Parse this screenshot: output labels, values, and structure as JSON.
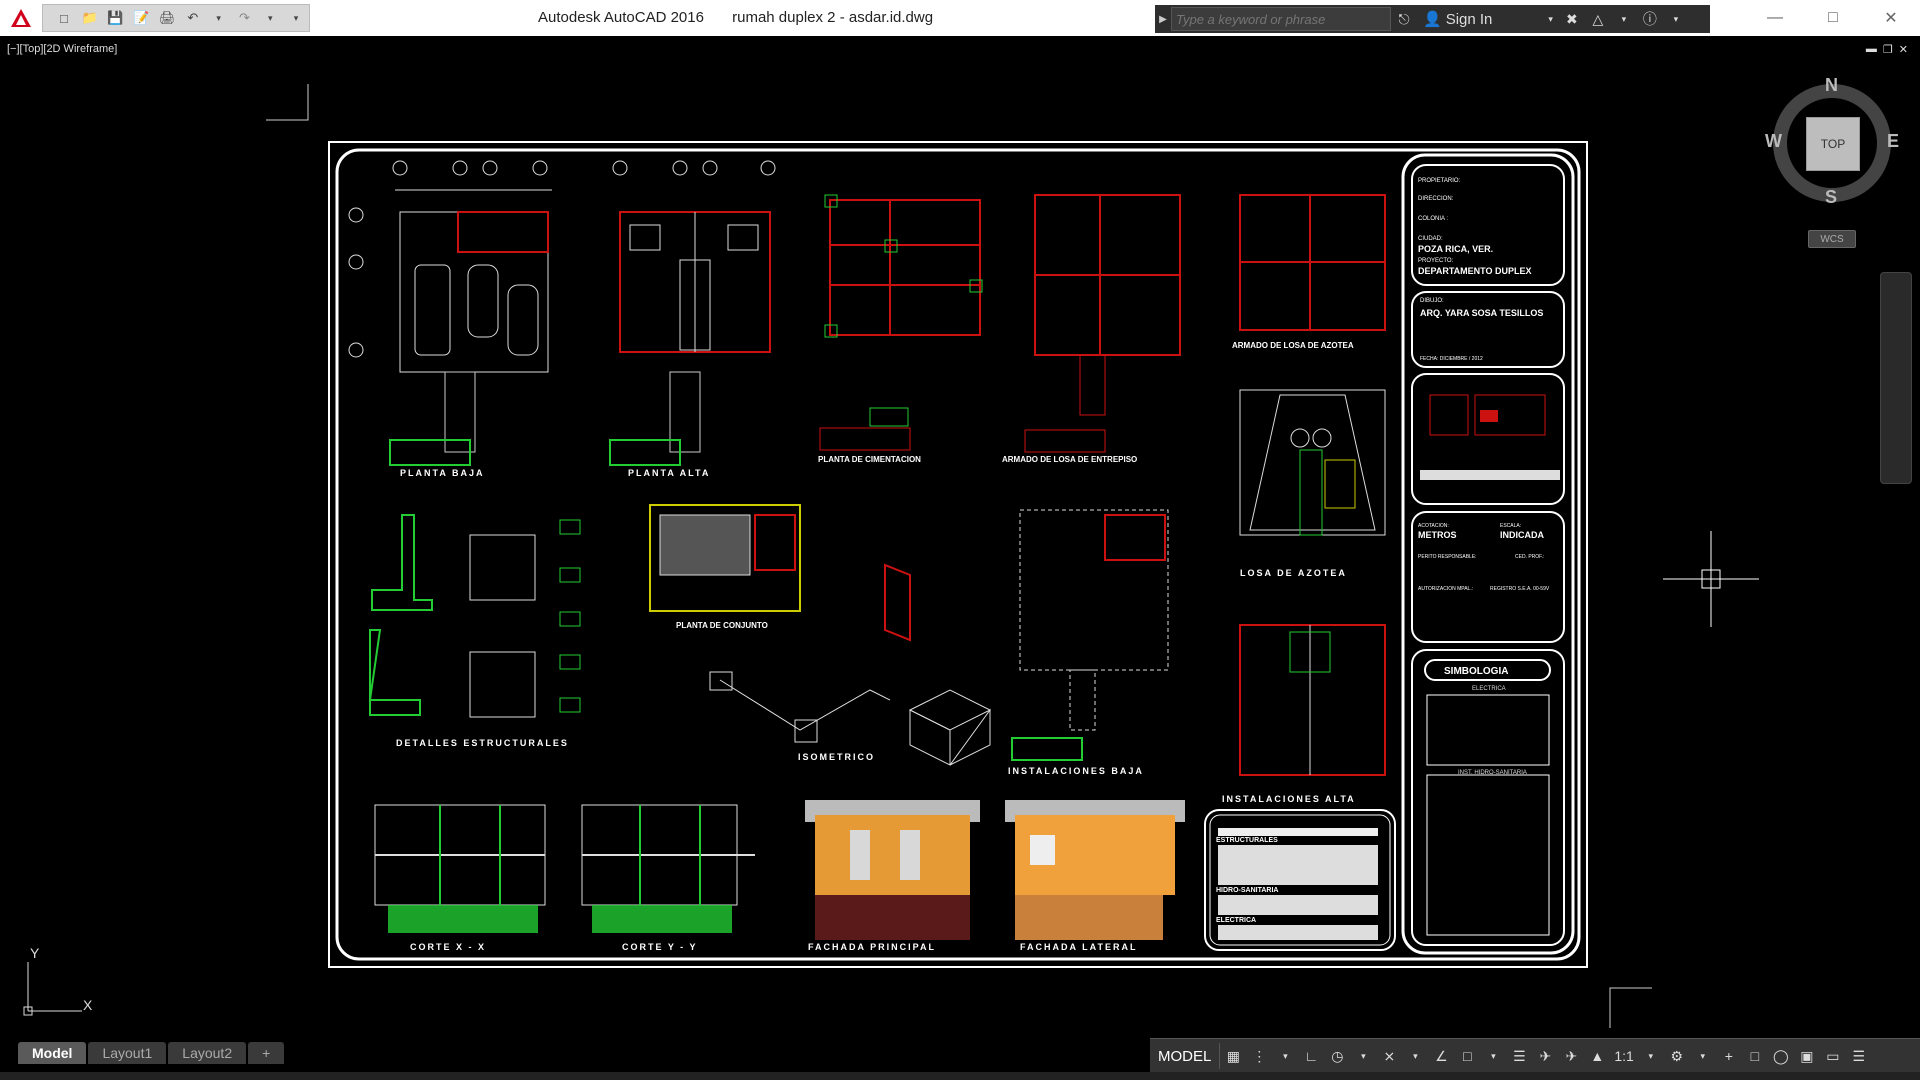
{
  "title_bar": {
    "app_name": "Autodesk AutoCAD 2016",
    "file_name": "rumah duplex 2 - asdar.id.dwg",
    "search_placeholder": "Type a keyword or phrase",
    "sign_in_label": "Sign In"
  },
  "viewport": {
    "label": "[−][Top][2D Wireframe]"
  },
  "viewcube": {
    "north": "N",
    "south": "S",
    "east": "E",
    "west": "W",
    "face": "TOP",
    "wcs": "WCS"
  },
  "sheet": {
    "labels": {
      "planta_baja": "PLANTA BAJA",
      "planta_alta": "PLANTA ALTA",
      "cimentacion": "PLANTA DE CIMENTACION",
      "armado_entrepiso": "ARMADO DE LOSA DE ENTREPISO",
      "armado_azotea": "ARMADO DE LOSA DE AZOTEA",
      "losa_azotea": "LOSA DE AZOTEA",
      "detalles": "DETALLES ESTRUCTURALES",
      "conjunto": "PLANTA DE CONJUNTO",
      "isometrico": "ISOMETRICO",
      "inst_baja": "INSTALACIONES BAJA",
      "inst_alta": "INSTALACIONES ALTA",
      "corte_x": "CORTE X - X",
      "corte_y": "CORTE Y - Y",
      "fachada_principal": "FACHADA PRINCIPAL",
      "fachada_lateral": "FACHADA LATERAL"
    },
    "title_block": {
      "propietario_label": "PROPIETARIO:",
      "direccion_label": "DIRECCION:",
      "colonia_label": "COLONIA :",
      "ciudad_label": "CIUDAD:",
      "ciudad": "POZA RICA, VER.",
      "proyecto_label": "PROYECTO:",
      "proyecto": "DEPARTAMENTO DUPLEX",
      "dibujo_label": "DIBUJO:",
      "dibujo": "ARQ. YARA SOSA TESILLOS",
      "fecha": "FECHA: DICIEMBRE / 2012",
      "acotacion_label": "ACOTACION:",
      "acotacion": "METROS",
      "escala_label": "ESCALA:",
      "escala": "INDICADA",
      "perito_label": "PERITO RESPONSABLE:",
      "ced_label": "CED. PROF.:",
      "autorizacion_label": "AUTORIZACION MPAL.:",
      "registro": "REGISTRO S.E.A. 00-59V",
      "simbologia": "SIMBOLOGIA",
      "electrica": "ELECTRICA",
      "hidro": "INST. HIDRO-SANITARIA",
      "notes_estructurales": "ESTRUCTURALES",
      "notes_hidro": "HIDRO-SANITARIA",
      "notes_electrica": "ELECTRICA"
    }
  },
  "ucs": {
    "y": "Y",
    "x": "X"
  },
  "layout_tabs": [
    {
      "label": "Model"
    },
    {
      "label": "Layout1"
    },
    {
      "label": "Layout2"
    },
    {
      "label": "+"
    }
  ],
  "status_bar": {
    "model_label": "MODEL",
    "scale_label": "1:1"
  },
  "colors": {
    "sheet_line": "#ffffff",
    "wall_red": "#cc1111",
    "green": "#22cc33",
    "yellow": "#cccc00",
    "background": "#000000"
  }
}
